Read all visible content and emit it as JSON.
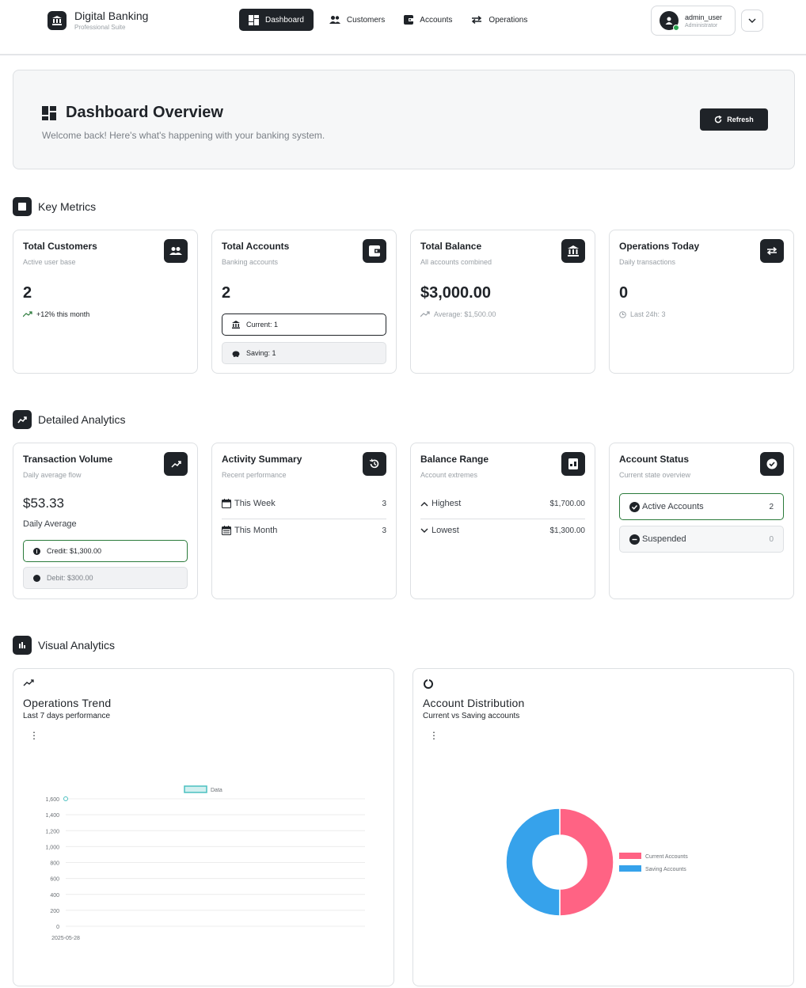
{
  "navbar": {
    "brand_title": "Digital Banking",
    "brand_subtitle": "Professional Suite",
    "links": [
      {
        "label": "Dashboard",
        "icon": "dashboard-icon",
        "active": true
      },
      {
        "label": "Customers",
        "icon": "users-icon",
        "active": false
      },
      {
        "label": "Accounts",
        "icon": "wallet-icon",
        "active": false
      },
      {
        "label": "Operations",
        "icon": "swap-icon",
        "active": false
      }
    ],
    "user": {
      "name": "admin_user",
      "role": "Administrator"
    }
  },
  "hero": {
    "title": "Dashboard Overview",
    "subtitle": "Welcome back! Here's what's happening with your banking system.",
    "refresh_label": "Refresh"
  },
  "sections": {
    "key_metrics": "Key Metrics",
    "detailed_analytics": "Detailed Analytics",
    "visual_analytics": "Visual Analytics"
  },
  "metrics": {
    "customers": {
      "title": "Total Customers",
      "subtitle": "Active user base",
      "value": "2",
      "foot": "+12% this month"
    },
    "accounts": {
      "title": "Total Accounts",
      "subtitle": "Banking accounts",
      "value": "2",
      "current": "Current: 1",
      "saving": "Saving: 1"
    },
    "balance": {
      "title": "Total Balance",
      "subtitle": "All accounts combined",
      "value": "$3,000.00",
      "foot": "Average: $1,500.00"
    },
    "operations": {
      "title": "Operations Today",
      "subtitle": "Daily transactions",
      "value": "0",
      "foot": "Last 24h: 3"
    }
  },
  "analytics": {
    "volume": {
      "title": "Transaction Volume",
      "subtitle": "Daily average flow",
      "value": "$53.33",
      "caption": "Daily Average",
      "credit": "Credit: $1,300.00",
      "debit": "Debit: $300.00"
    },
    "activity": {
      "title": "Activity Summary",
      "subtitle": "Recent performance",
      "rows": [
        {
          "label": "This Week",
          "value": "3"
        },
        {
          "label": "This Month",
          "value": "3"
        }
      ]
    },
    "range": {
      "title": "Balance Range",
      "subtitle": "Account extremes",
      "rows": [
        {
          "label": "Highest",
          "value": "$1,700.00"
        },
        {
          "label": "Lowest",
          "value": "$1,300.00"
        }
      ]
    },
    "status": {
      "title": "Account Status",
      "subtitle": "Current state overview",
      "rows": [
        {
          "label": "Active Accounts",
          "value": "2"
        },
        {
          "label": "Suspended",
          "value": "0"
        }
      ]
    }
  },
  "charts": {
    "trend": {
      "title": "Operations Trend",
      "subtitle": "Last 7 days performance"
    },
    "distribution": {
      "title": "Account Distribution",
      "subtitle": "Current vs Saving accounts"
    }
  },
  "colors": {
    "accent": "#1f2328",
    "success": "#2a7a3a",
    "line_series": "#4bc0c0",
    "pie_current": "#ff6384",
    "pie_saving": "#36a2eb"
  },
  "chart_data": [
    {
      "type": "line",
      "x": [
        "2025-05-28"
      ],
      "series": [
        {
          "name": "Data",
          "values": [
            1600
          ]
        }
      ],
      "ylim": [
        0,
        1600
      ],
      "yticks": [
        0,
        200,
        400,
        600,
        800,
        1000,
        1200,
        1400,
        1600
      ],
      "legend": "top"
    },
    {
      "type": "pie",
      "categories": [
        "Current Accounts",
        "Saving Accounts"
      ],
      "values": [
        1,
        1
      ],
      "legend": "right"
    }
  ]
}
